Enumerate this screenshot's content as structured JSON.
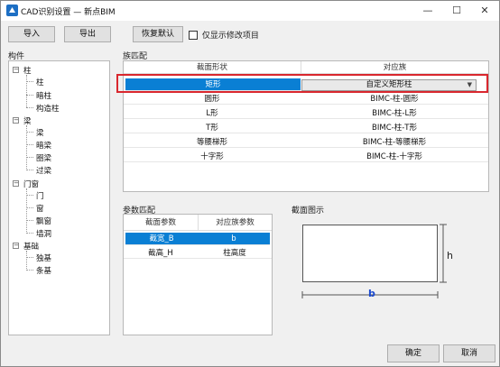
{
  "window": {
    "title": "CAD识别设置 — 新点BIM",
    "minimize": "—",
    "maximize": "☐",
    "close": "✕"
  },
  "toolbar": {
    "import_label": "导入",
    "export_label": "导出",
    "restore_label": "恢复默认",
    "show_modified_label": "仅显示修改项目",
    "show_modified_checked": false
  },
  "components": {
    "title": "构件",
    "tree": [
      {
        "label": "柱",
        "children": [
          "柱",
          "暗柱",
          "构造柱"
        ]
      },
      {
        "label": "梁",
        "children": [
          "梁",
          "暗梁",
          "圈梁",
          "过梁"
        ]
      },
      {
        "label": "门窗",
        "children": [
          "门",
          "窗",
          "飘窗",
          "墙洞"
        ]
      },
      {
        "label": "基础",
        "children": [
          "独基",
          "条基"
        ]
      }
    ]
  },
  "family_match": {
    "title": "族匹配",
    "col_shape": "截面形状",
    "col_family": "对应族",
    "rows": [
      {
        "shape": "矩形",
        "family": "自定义矩形柱"
      },
      {
        "shape": "圆形",
        "family": "BIMC-柱-圆形"
      },
      {
        "shape": "L形",
        "family": "BIMC-柱-L形"
      },
      {
        "shape": "T形",
        "family": "BIMC-柱-T形"
      },
      {
        "shape": "等腰梯形",
        "family": "BIMC-柱-等腰梯形"
      },
      {
        "shape": "十字形",
        "family": "BIMC-柱-十字形"
      }
    ]
  },
  "param_match": {
    "title": "参数匹配",
    "col_section": "截面参数",
    "col_family": "对应族参数",
    "rows": [
      {
        "section": "截宽_B",
        "family": "b"
      },
      {
        "section": "截高_H",
        "family": "柱高度"
      }
    ]
  },
  "section_diagram": {
    "title": "截面图示",
    "h_label": "h",
    "b_label": "b"
  },
  "footer": {
    "ok_label": "确定",
    "cancel_label": "取消"
  },
  "colors": {
    "selection": "#0a7fd4",
    "highlight_border": "#d9272e"
  }
}
